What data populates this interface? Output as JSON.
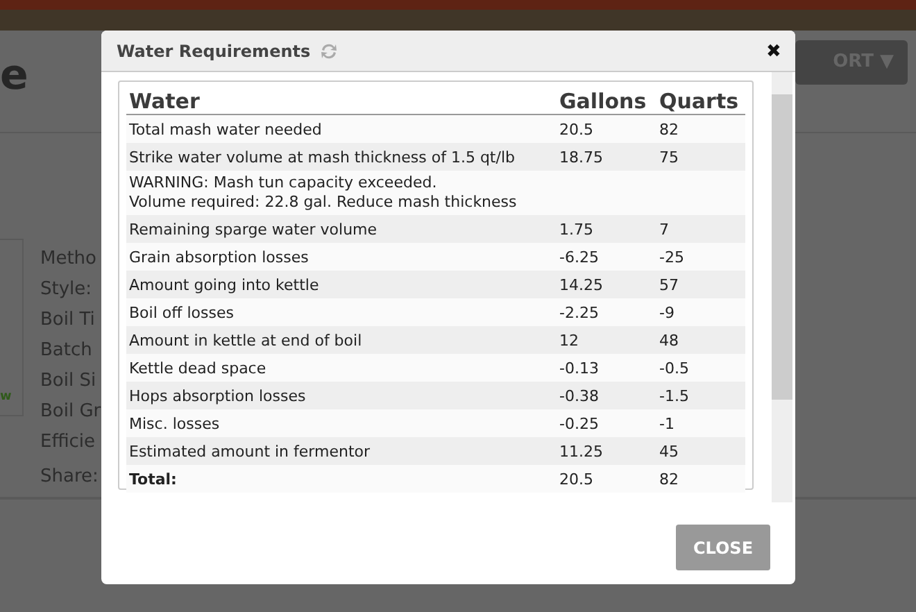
{
  "background": {
    "heading": "e",
    "sort_button": "ORT ▼",
    "badge": "w",
    "fields": [
      "Metho",
      "Style:",
      "Boil Ti",
      "Batch",
      "Boil Si",
      "Boil Gr",
      "Efficie"
    ],
    "share": "Share:"
  },
  "dialog": {
    "title": "Water Requirements",
    "close_icon": "✖",
    "columns": [
      "Water",
      "Gallons",
      "Quarts"
    ],
    "rows": [
      {
        "kind": "value",
        "label": "Total mash water needed",
        "gallons": "20.5",
        "quarts": "82"
      },
      {
        "kind": "value",
        "label": "Strike water volume at mash thickness of 1.5 qt/lb",
        "gallons": "18.75",
        "quarts": "75"
      },
      {
        "kind": "warning",
        "lines": [
          "WARNING: Mash tun capacity exceeded.",
          "Volume required: 22.8 gal. Reduce mash thickness"
        ]
      },
      {
        "kind": "value",
        "label": "Remaining sparge water volume",
        "gallons": "1.75",
        "quarts": "7"
      },
      {
        "kind": "value",
        "label": "Grain absorption losses",
        "gallons": "-6.25",
        "quarts": "-25"
      },
      {
        "kind": "value",
        "label": "Amount going into kettle",
        "gallons": "14.25",
        "quarts": "57"
      },
      {
        "kind": "value",
        "label": "Boil off losses",
        "gallons": "-2.25",
        "quarts": "-9"
      },
      {
        "kind": "value",
        "label": "Amount in kettle at end of boil",
        "gallons": "12",
        "quarts": "48"
      },
      {
        "kind": "value",
        "label": "Kettle dead space",
        "gallons": "-0.13",
        "quarts": "-0.5"
      },
      {
        "kind": "value",
        "label": "Hops absorption losses",
        "gallons": "-0.38",
        "quarts": "-1.5"
      },
      {
        "kind": "value",
        "label": "Misc. losses",
        "gallons": "-0.25",
        "quarts": "-1"
      },
      {
        "kind": "value",
        "label": "Estimated amount in fermentor",
        "gallons": "11.25",
        "quarts": "45"
      },
      {
        "kind": "total",
        "label": "Total:",
        "gallons": "20.5",
        "quarts": "82"
      }
    ],
    "button": "CLOSE"
  }
}
